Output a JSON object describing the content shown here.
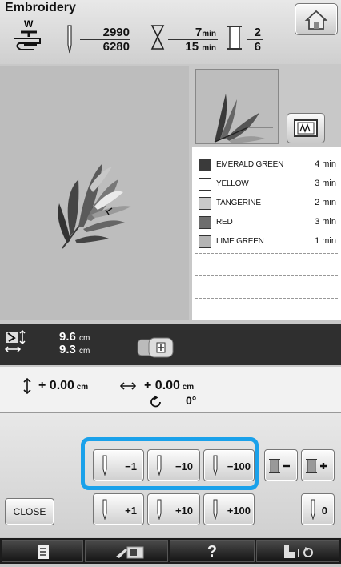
{
  "header": {
    "title": "Embroidery",
    "stitch_current": "2990",
    "stitch_total": "6280",
    "time_current": "7",
    "time_total": "15",
    "time_unit": "min",
    "color_current": "2",
    "color_total": "6"
  },
  "colors": [
    {
      "name": "EMERALD GREEN",
      "time": "4 min",
      "swatch": "#3a3a3a"
    },
    {
      "name": "YELLOW",
      "time": "3 min",
      "swatch": "#ffffff"
    },
    {
      "name": "TANGERINE",
      "time": "2 min",
      "swatch": "#c8c8c8"
    },
    {
      "name": "RED",
      "time": "3 min",
      "swatch": "#6e6e6e"
    },
    {
      "name": "LIME GREEN",
      "time": "1 min",
      "swatch": "#b4b4b4"
    }
  ],
  "size": {
    "height": "9.6",
    "width": "9.3",
    "unit": "cm"
  },
  "offset": {
    "vertical": "+ 0.00",
    "horizontal": "+ 0.00",
    "unit": "cm",
    "angle": "0°"
  },
  "controls": {
    "back1": "−1",
    "back10": "−10",
    "back100": "−100",
    "fwd1": "+1",
    "fwd10": "+10",
    "fwd100": "+100",
    "zero": "0",
    "close": "CLOSE"
  },
  "bottom": {
    "help": "?"
  },
  "accent_color": "#1aa1ea"
}
